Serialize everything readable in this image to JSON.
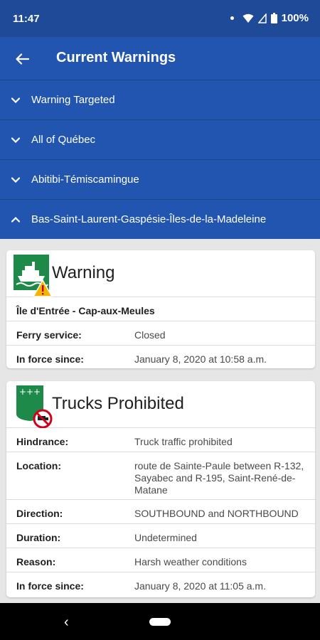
{
  "status": {
    "time": "11:47",
    "battery": "100%"
  },
  "header": {
    "title": "Current Warnings"
  },
  "sections": [
    {
      "label": "Warning Targeted",
      "expanded": false
    },
    {
      "label": "All of Québec",
      "expanded": false
    },
    {
      "label": "Abitibi-Témiscamingue",
      "expanded": false
    },
    {
      "label": "Bas-Saint-Laurent-Gaspésie-Îles-de-la-Madeleine",
      "expanded": true
    }
  ],
  "cards": [
    {
      "icon": "ferry-warning-icon",
      "title": "Warning",
      "location": "Île d'Entrée - Cap-aux-Meules",
      "rows": [
        {
          "label": "Ferry service:",
          "value": "Closed"
        },
        {
          "label": "In force since:",
          "value": "January 8, 2020 at 10:58 a.m."
        }
      ]
    },
    {
      "icon": "trucks-prohibited-icon",
      "title": "Trucks Prohibited",
      "rows": [
        {
          "label": "Hindrance:",
          "value": "Truck traffic prohibited"
        },
        {
          "label": "Location:",
          "value": "route de Sainte-Paule between R-132, Sayabec and R-195, Saint-René-de-Matane"
        },
        {
          "label": "Direction:",
          "value": "SOUTHBOUND and NORTHBOUND"
        },
        {
          "label": "Duration:",
          "value": "Undetermined"
        },
        {
          "label": "Reason:",
          "value": "Harsh weather conditions"
        },
        {
          "label": "In force since:",
          "value": "January 8, 2020 at 11:05 a.m."
        }
      ]
    }
  ],
  "colors": {
    "status_bar": "#1f4a97",
    "app_bar": "#2255b0",
    "background": "#e6e6e6",
    "sign_green": "#1d8a4a"
  }
}
